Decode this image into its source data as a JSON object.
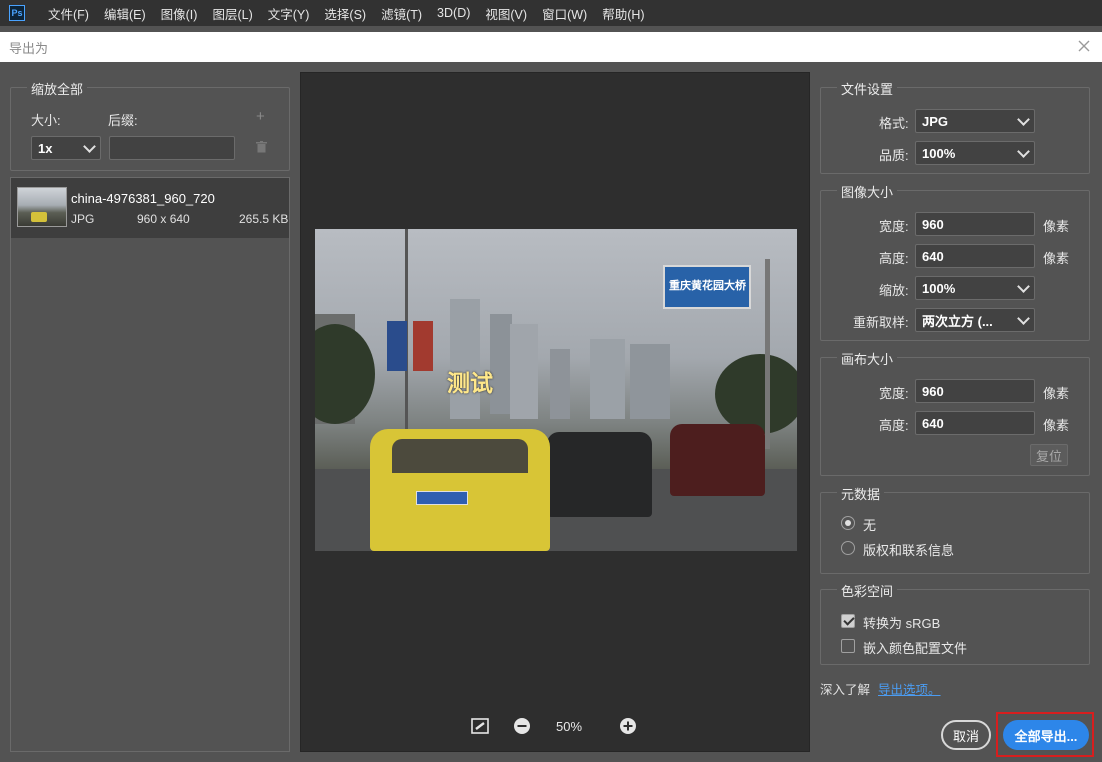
{
  "app": {
    "logo": "Ps"
  },
  "menu": [
    "文件(F)",
    "编辑(E)",
    "图像(I)",
    "图层(L)",
    "文字(Y)",
    "选择(S)",
    "滤镜(T)",
    "3D(D)",
    "视图(V)",
    "窗口(W)",
    "帮助(H)"
  ],
  "dialog": {
    "title": "导出为"
  },
  "left": {
    "group_title": "缩放全部",
    "size_label": "大小:",
    "suffix_label": "后缀:",
    "size_value": "1x",
    "suffix_value": "",
    "item": {
      "name": "china-4976381_960_720",
      "format": "JPG",
      "dimensions": "960 x 640",
      "filesize": "265.5 KB"
    }
  },
  "preview": {
    "zoom": "50%",
    "sign_text": "重庆黄花园大桥",
    "watermark": "测试"
  },
  "file_settings": {
    "title": "文件设置",
    "format_label": "格式:",
    "format_value": "JPG",
    "quality_label": "品质:",
    "quality_value": "100%"
  },
  "image_size": {
    "title": "图像大小",
    "width_label": "宽度:",
    "width_value": "960",
    "height_label": "高度:",
    "height_value": "640",
    "unit": "像素",
    "scale_label": "缩放:",
    "scale_value": "100%",
    "resample_label": "重新取样:",
    "resample_value": "两次立方 (..."
  },
  "canvas_size": {
    "title": "画布大小",
    "width_label": "宽度:",
    "width_value": "960",
    "height_label": "高度:",
    "height_value": "640",
    "unit": "像素",
    "reset_label": "复位"
  },
  "metadata": {
    "title": "元数据",
    "option_none": "无",
    "option_copyright": "版权和联系信息"
  },
  "color_space": {
    "title": "色彩空间",
    "convert_srgb": "转换为 sRGB",
    "embed_profile": "嵌入颜色配置文件"
  },
  "footer": {
    "learn_more": "深入了解",
    "export_options_link": "导出选项。",
    "cancel": "取消",
    "export_all": "全部导出..."
  },
  "colors": {
    "accent": "#2d86e9",
    "highlight_border": "#d81e1e",
    "link": "#4b9cf2"
  }
}
